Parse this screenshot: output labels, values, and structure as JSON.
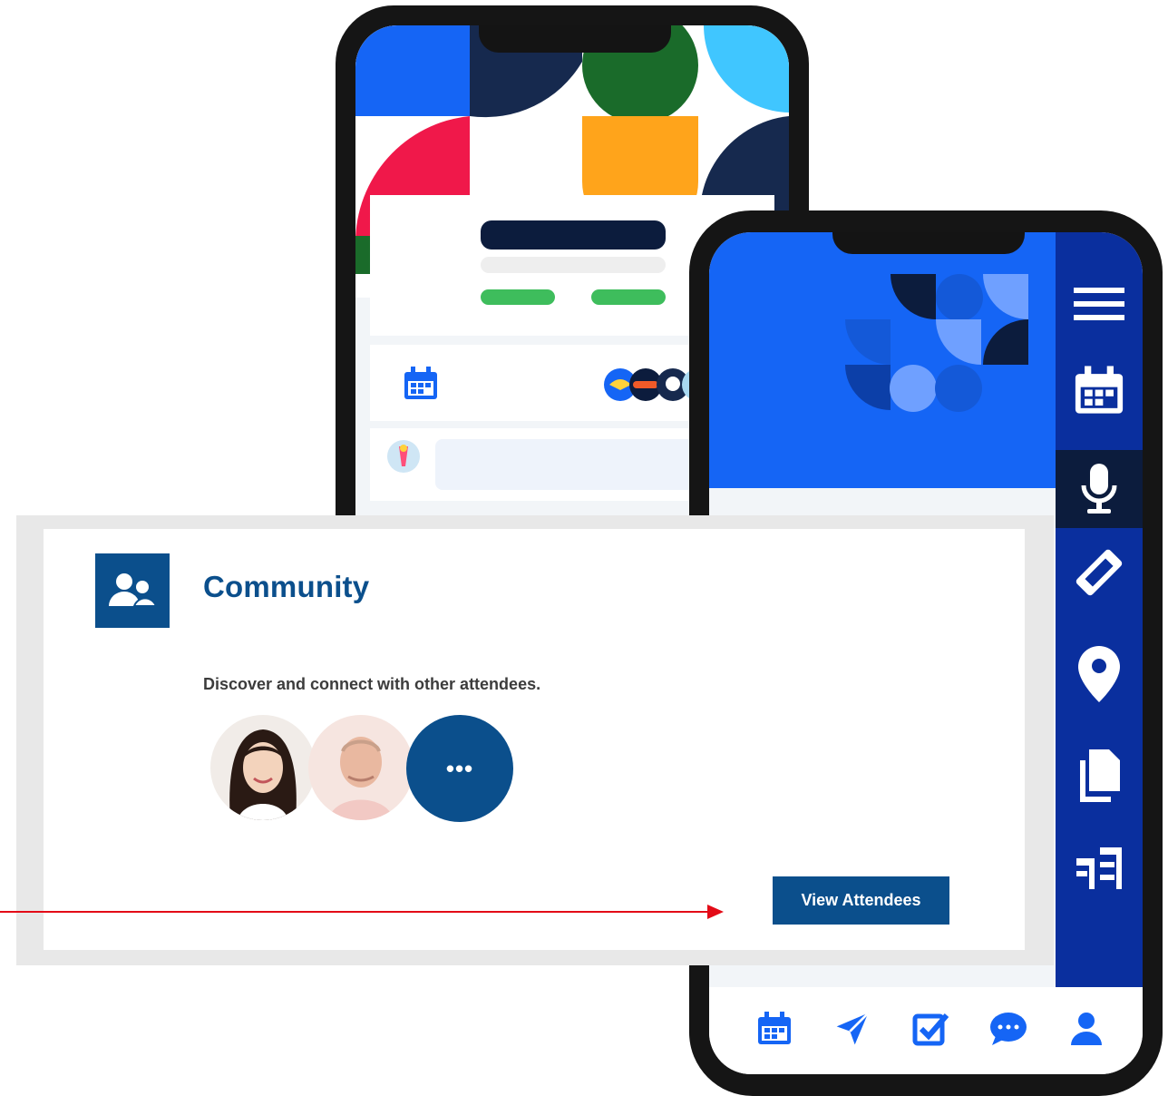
{
  "community": {
    "title": "Community",
    "description": "Discover and connect with other attendees.",
    "view_button_label": "View Attendees",
    "more_label": "•••",
    "icon": "users-icon"
  },
  "app_sidebar": {
    "items": [
      "menu-icon",
      "calendar-icon",
      "microphone-icon",
      "ticket-icon",
      "location-pin-icon",
      "document-icon",
      "sponsors-icon"
    ],
    "active": "microphone-icon"
  },
  "app_bottom_nav": {
    "items": [
      "calendar-icon",
      "send-icon",
      "checklist-icon",
      "chat-icon",
      "profile-icon"
    ]
  },
  "colors": {
    "brand_blue": "#0b4f8c",
    "app_blue": "#1565f5",
    "sidebar_blue": "#0a2f9e",
    "annotation_red": "#e30b17"
  }
}
